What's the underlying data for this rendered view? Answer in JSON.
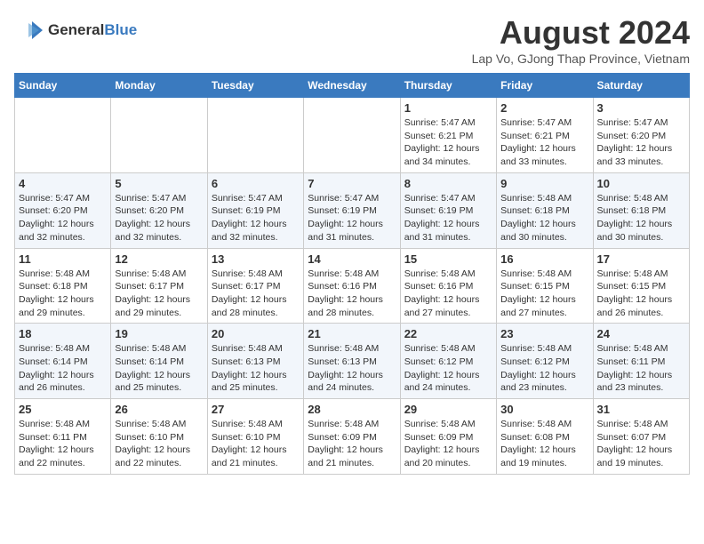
{
  "header": {
    "logo_general": "General",
    "logo_blue": "Blue",
    "month_title": "August 2024",
    "subtitle": "Lap Vo, GJong Thap Province, Vietnam"
  },
  "weekdays": [
    "Sunday",
    "Monday",
    "Tuesday",
    "Wednesday",
    "Thursday",
    "Friday",
    "Saturday"
  ],
  "weeks": [
    [
      {
        "day": "",
        "info": ""
      },
      {
        "day": "",
        "info": ""
      },
      {
        "day": "",
        "info": ""
      },
      {
        "day": "",
        "info": ""
      },
      {
        "day": "1",
        "info": "Sunrise: 5:47 AM\nSunset: 6:21 PM\nDaylight: 12 hours and 34 minutes."
      },
      {
        "day": "2",
        "info": "Sunrise: 5:47 AM\nSunset: 6:21 PM\nDaylight: 12 hours and 33 minutes."
      },
      {
        "day": "3",
        "info": "Sunrise: 5:47 AM\nSunset: 6:20 PM\nDaylight: 12 hours and 33 minutes."
      }
    ],
    [
      {
        "day": "4",
        "info": "Sunrise: 5:47 AM\nSunset: 6:20 PM\nDaylight: 12 hours and 32 minutes."
      },
      {
        "day": "5",
        "info": "Sunrise: 5:47 AM\nSunset: 6:20 PM\nDaylight: 12 hours and 32 minutes."
      },
      {
        "day": "6",
        "info": "Sunrise: 5:47 AM\nSunset: 6:19 PM\nDaylight: 12 hours and 32 minutes."
      },
      {
        "day": "7",
        "info": "Sunrise: 5:47 AM\nSunset: 6:19 PM\nDaylight: 12 hours and 31 minutes."
      },
      {
        "day": "8",
        "info": "Sunrise: 5:47 AM\nSunset: 6:19 PM\nDaylight: 12 hours and 31 minutes."
      },
      {
        "day": "9",
        "info": "Sunrise: 5:48 AM\nSunset: 6:18 PM\nDaylight: 12 hours and 30 minutes."
      },
      {
        "day": "10",
        "info": "Sunrise: 5:48 AM\nSunset: 6:18 PM\nDaylight: 12 hours and 30 minutes."
      }
    ],
    [
      {
        "day": "11",
        "info": "Sunrise: 5:48 AM\nSunset: 6:18 PM\nDaylight: 12 hours and 29 minutes."
      },
      {
        "day": "12",
        "info": "Sunrise: 5:48 AM\nSunset: 6:17 PM\nDaylight: 12 hours and 29 minutes."
      },
      {
        "day": "13",
        "info": "Sunrise: 5:48 AM\nSunset: 6:17 PM\nDaylight: 12 hours and 28 minutes."
      },
      {
        "day": "14",
        "info": "Sunrise: 5:48 AM\nSunset: 6:16 PM\nDaylight: 12 hours and 28 minutes."
      },
      {
        "day": "15",
        "info": "Sunrise: 5:48 AM\nSunset: 6:16 PM\nDaylight: 12 hours and 27 minutes."
      },
      {
        "day": "16",
        "info": "Sunrise: 5:48 AM\nSunset: 6:15 PM\nDaylight: 12 hours and 27 minutes."
      },
      {
        "day": "17",
        "info": "Sunrise: 5:48 AM\nSunset: 6:15 PM\nDaylight: 12 hours and 26 minutes."
      }
    ],
    [
      {
        "day": "18",
        "info": "Sunrise: 5:48 AM\nSunset: 6:14 PM\nDaylight: 12 hours and 26 minutes."
      },
      {
        "day": "19",
        "info": "Sunrise: 5:48 AM\nSunset: 6:14 PM\nDaylight: 12 hours and 25 minutes."
      },
      {
        "day": "20",
        "info": "Sunrise: 5:48 AM\nSunset: 6:13 PM\nDaylight: 12 hours and 25 minutes."
      },
      {
        "day": "21",
        "info": "Sunrise: 5:48 AM\nSunset: 6:13 PM\nDaylight: 12 hours and 24 minutes."
      },
      {
        "day": "22",
        "info": "Sunrise: 5:48 AM\nSunset: 6:12 PM\nDaylight: 12 hours and 24 minutes."
      },
      {
        "day": "23",
        "info": "Sunrise: 5:48 AM\nSunset: 6:12 PM\nDaylight: 12 hours and 23 minutes."
      },
      {
        "day": "24",
        "info": "Sunrise: 5:48 AM\nSunset: 6:11 PM\nDaylight: 12 hours and 23 minutes."
      }
    ],
    [
      {
        "day": "25",
        "info": "Sunrise: 5:48 AM\nSunset: 6:11 PM\nDaylight: 12 hours and 22 minutes."
      },
      {
        "day": "26",
        "info": "Sunrise: 5:48 AM\nSunset: 6:10 PM\nDaylight: 12 hours and 22 minutes."
      },
      {
        "day": "27",
        "info": "Sunrise: 5:48 AM\nSunset: 6:10 PM\nDaylight: 12 hours and 21 minutes."
      },
      {
        "day": "28",
        "info": "Sunrise: 5:48 AM\nSunset: 6:09 PM\nDaylight: 12 hours and 21 minutes."
      },
      {
        "day": "29",
        "info": "Sunrise: 5:48 AM\nSunset: 6:09 PM\nDaylight: 12 hours and 20 minutes."
      },
      {
        "day": "30",
        "info": "Sunrise: 5:48 AM\nSunset: 6:08 PM\nDaylight: 12 hours and 19 minutes."
      },
      {
        "day": "31",
        "info": "Sunrise: 5:48 AM\nSunset: 6:07 PM\nDaylight: 12 hours and 19 minutes."
      }
    ]
  ]
}
